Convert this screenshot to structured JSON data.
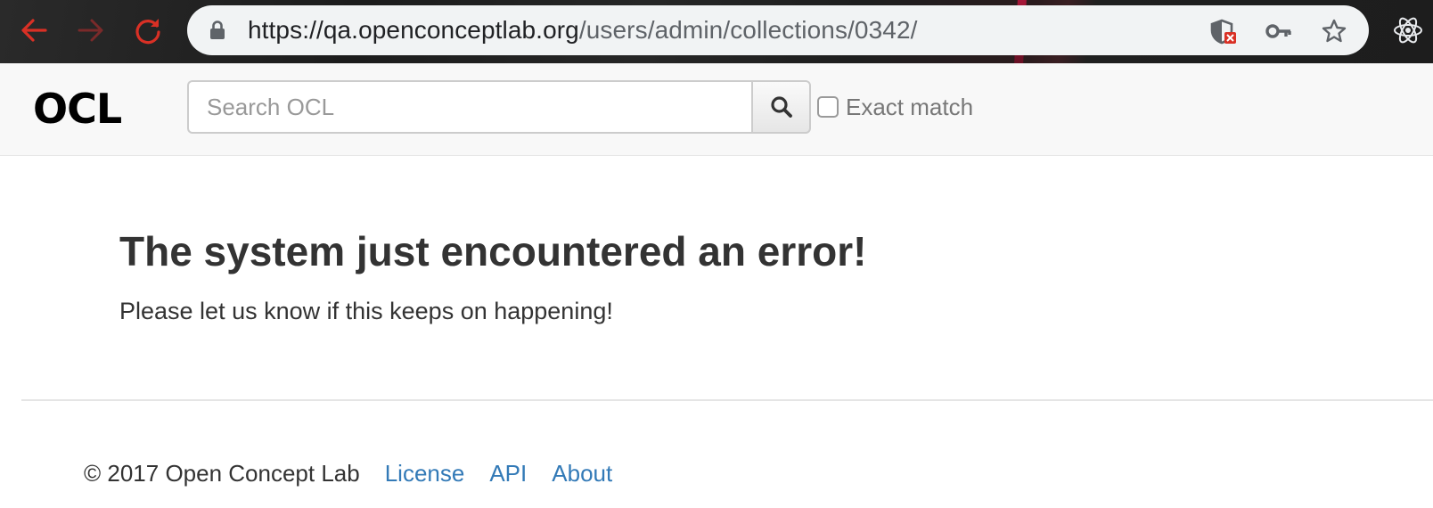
{
  "browser": {
    "url_host": "https://qa.openconceptlab.org",
    "url_path": "/users/admin/collections/0342/",
    "accent_color": "#d93025"
  },
  "navbar": {
    "brand": "OCL",
    "search_placeholder": "Search OCL",
    "exact_match_label": "Exact match",
    "exact_match_checked": false
  },
  "main": {
    "error_title": "The system just encountered an error!",
    "error_message": "Please let us know if this keeps on happening!"
  },
  "footer": {
    "copyright": "© 2017 Open Concept Lab",
    "links": [
      "License",
      "API",
      "About"
    ],
    "link_color": "#337ab7"
  },
  "icons": [
    "back-arrow-icon",
    "forward-arrow-icon",
    "reload-icon",
    "lock-icon",
    "shield-blocked-icon",
    "key-icon",
    "star-icon",
    "react-extension-icon",
    "search-icon"
  ]
}
